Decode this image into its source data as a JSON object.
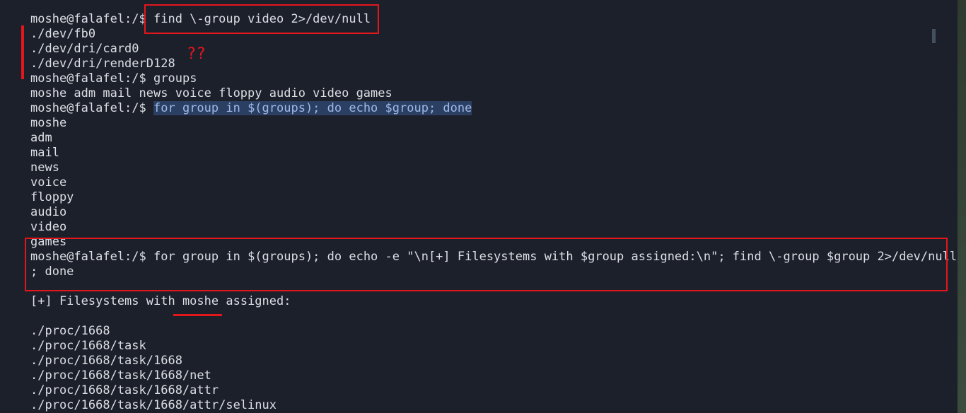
{
  "terminal": {
    "prompt": "moshe@falafel:/$",
    "commands": {
      "find_video": "find \\-group video 2>/dev/null",
      "groups": "groups",
      "loop_echo": "for group in $(groups); do echo $group; done",
      "loop_find_line1": "for group in $(groups); do echo -e \"\\n[+] Filesystems with $group assigned:\\n\"; find \\-group $group 2>/dev/null",
      "loop_find_line2": "; done"
    },
    "find_video_output": [
      "./dev/fb0",
      "./dev/dri/card0",
      "./dev/dri/renderD128"
    ],
    "groups_output": "moshe adm mail news voice floppy audio video games",
    "group_list": [
      "moshe",
      "adm",
      "mail",
      "news",
      "voice",
      "floppy",
      "audio",
      "video",
      "games"
    ],
    "header_prefix": "[+] Filesystems with ",
    "header_group": "moshe",
    "header_suffix": " assigned:",
    "moshe_files": [
      "./proc/1668",
      "./proc/1668/task",
      "./proc/1668/task/1668",
      "./proc/1668/task/1668/net",
      "./proc/1668/task/1668/attr",
      "./proc/1668/task/1668/attr/selinux"
    ]
  },
  "annotations": {
    "question_marks": "??",
    "color": "#e3161c"
  },
  "colors": {
    "background": "#1c202b",
    "text": "#dcdfe4",
    "selection_bg": "#2b3f63",
    "selection_text": "#9fb9e8"
  }
}
